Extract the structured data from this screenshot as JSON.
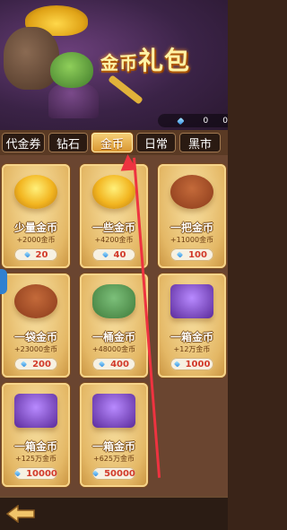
{
  "banner": {
    "title_main": "金币",
    "title_big": "礼包",
    "gem_count": "0",
    "coin_count": "0"
  },
  "tabs": [
    {
      "label": "代金券",
      "active": false
    },
    {
      "label": "钻石",
      "active": false
    },
    {
      "label": "金币",
      "active": true
    },
    {
      "label": "日常",
      "active": false
    },
    {
      "label": "黑市",
      "active": false
    }
  ],
  "cards": [
    {
      "name": "少量金币",
      "desc": "+2000金币",
      "price": "20",
      "art": "pile"
    },
    {
      "name": "一些金币",
      "desc": "+4200金币",
      "price": "40",
      "art": "pile"
    },
    {
      "name": "一把金币",
      "desc": "+11000金币",
      "price": "100",
      "art": "bag"
    },
    {
      "name": "一袋金币",
      "desc": "+23000金币",
      "price": "200",
      "art": "bag"
    },
    {
      "name": "一桶金币",
      "desc": "+48000金币",
      "price": "400",
      "art": "barrel"
    },
    {
      "name": "一箱金币",
      "desc": "+12万金币",
      "price": "1000",
      "art": "chest"
    },
    {
      "name": "一箱金币",
      "desc": "+125万金币",
      "price": "10000",
      "art": "chest"
    },
    {
      "name": "一箱金币",
      "desc": "+625万金币",
      "price": "50000",
      "art": "chest"
    }
  ],
  "colors": {
    "price_text": "#d23a2a",
    "annotation_arrow": "#ee3340",
    "tab_active": "#e2a43f"
  },
  "icons": {
    "gem": "gem-icon",
    "back": "back-arrow-icon"
  }
}
